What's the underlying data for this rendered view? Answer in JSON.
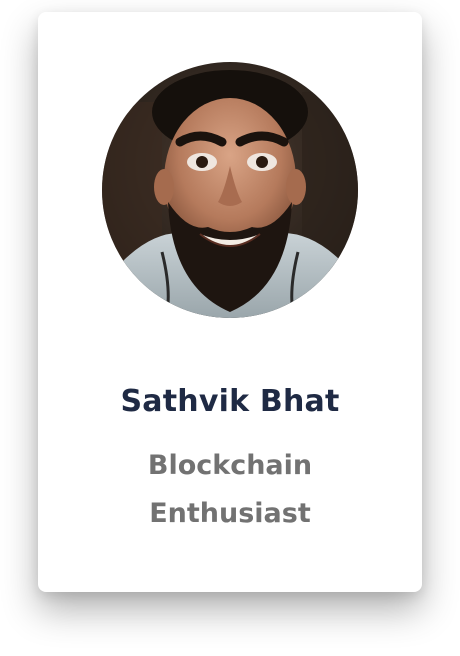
{
  "profile": {
    "name": "Sathvik Bhat",
    "title": "Blockchain Enthusiast",
    "photo_icon": "profile-photo"
  },
  "colors": {
    "name": "#1f2a44",
    "title": "#727272",
    "card_background": "#ffffff"
  }
}
